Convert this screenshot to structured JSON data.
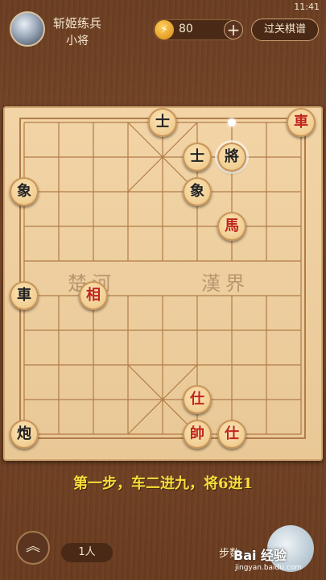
{
  "status": {
    "time": "11:41"
  },
  "header": {
    "player_name": "斩姬练兵",
    "player_rank": "小将",
    "energy_icon": "lightning-icon",
    "energy_value": "80",
    "plus_label": "+",
    "record_button": "过关棋谱"
  },
  "board": {
    "river_left": "楚河",
    "river_right": "漢界",
    "pieces": [
      {
        "name": "piece-black-advisor-top",
        "char": "士",
        "side": "black",
        "file": 4,
        "rank": 0
      },
      {
        "name": "piece-black-chariot",
        "char": "車",
        "side": "red",
        "file": 8,
        "rank": 0
      },
      {
        "name": "piece-black-advisor-mid",
        "char": "士",
        "side": "black",
        "file": 5,
        "rank": 1
      },
      {
        "name": "piece-black-general",
        "char": "將",
        "side": "black",
        "file": 6,
        "rank": 1,
        "selected": true
      },
      {
        "name": "piece-black-elephant-left",
        "char": "象",
        "side": "black",
        "file": 0,
        "rank": 2
      },
      {
        "name": "piece-black-elephant-mid",
        "char": "象",
        "side": "black",
        "file": 5,
        "rank": 2
      },
      {
        "name": "piece-red-horse",
        "char": "馬",
        "side": "red",
        "file": 6,
        "rank": 3
      },
      {
        "name": "piece-black-chariot-left",
        "char": "車",
        "side": "black",
        "file": 0,
        "rank": 5
      },
      {
        "name": "piece-red-elephant",
        "char": "相",
        "side": "red",
        "file": 2,
        "rank": 5
      },
      {
        "name": "piece-red-advisor-mid",
        "char": "仕",
        "side": "red",
        "file": 5,
        "rank": 8
      },
      {
        "name": "piece-black-cannon",
        "char": "炮",
        "side": "black",
        "file": 0,
        "rank": 9
      },
      {
        "name": "piece-red-general",
        "char": "帥",
        "side": "red",
        "file": 5,
        "rank": 9
      },
      {
        "name": "piece-red-advisor-right",
        "char": "仕",
        "side": "red",
        "file": 6,
        "rank": 9
      }
    ],
    "move_marker": {
      "file": 6,
      "rank": 0
    }
  },
  "hint": "第一步，车二进九，将6进1",
  "footer": {
    "menu_icon": "chevron-up-icon",
    "player_count": "1人",
    "steps_label": "步数",
    "watermark": "Bai 经验",
    "watermark_sub": "jingyan.baidu.com"
  }
}
